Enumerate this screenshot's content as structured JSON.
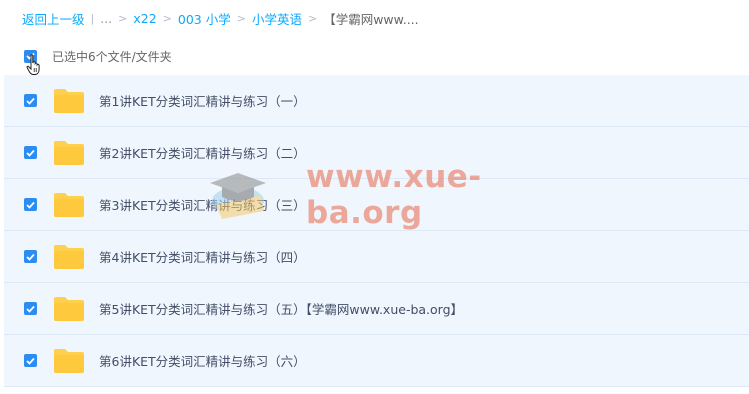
{
  "breadcrumb": {
    "back": "返回上一级",
    "ellipsis": "...",
    "items": [
      "x22",
      "003 小学",
      "小学英语"
    ],
    "current": "【学霸网www...."
  },
  "selection": {
    "label": "已选中6个文件/文件夹",
    "all_checked": true
  },
  "files": [
    {
      "name": "第1讲KET分类词汇精讲与练习（一）",
      "type": "folder",
      "checked": true
    },
    {
      "name": "第2讲KET分类词汇精讲与练习（二）",
      "type": "folder",
      "checked": true
    },
    {
      "name": "第3讲KET分类词汇精讲与练习（三）",
      "type": "folder",
      "checked": true
    },
    {
      "name": "第4讲KET分类词汇精讲与练习（四）",
      "type": "folder",
      "checked": true
    },
    {
      "name": "第5讲KET分类词汇精讲与练习（五）【学霸网www.xue-ba.org】",
      "type": "folder",
      "checked": true
    },
    {
      "name": "第6讲KET分类词汇精讲与练习（六）",
      "type": "folder",
      "checked": true
    }
  ],
  "watermark": {
    "text": "www.xue-ba.org"
  },
  "colors": {
    "link": "#09aaff",
    "checkbox": "#2d8cf0",
    "row_bg": "#f0f6fd",
    "folder": "#ffd04b",
    "watermark": "#e8765e"
  }
}
